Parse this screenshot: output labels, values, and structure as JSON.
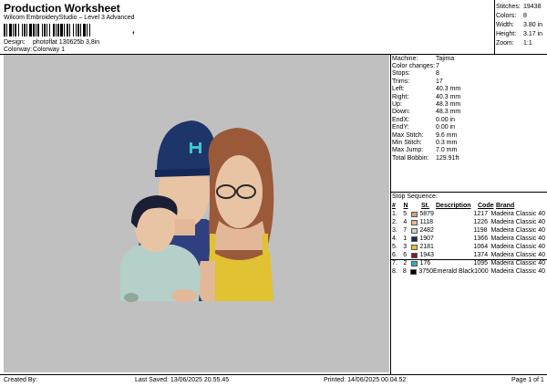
{
  "header": {
    "title": "Production Worksheet",
    "subtitle": "Wilcom EmbroideryStudio – Level 3 Advanced",
    "barcode_suffix": ","
  },
  "design_info": {
    "design_label": "Design:",
    "design_value": "photoflat 130625b 3,8in",
    "colorway_label": "Colorway:",
    "colorway_value": "Colorway 1"
  },
  "stats": [
    {
      "key": "Stitches:",
      "value": "19438"
    },
    {
      "key": "Colors:",
      "value": "8"
    },
    {
      "key": "Width:",
      "value": "3.80 in"
    },
    {
      "key": "Height:",
      "value": "3.17 in"
    },
    {
      "key": "Zoom:",
      "value": "1:1"
    }
  ],
  "machine_info": [
    {
      "key": "Machine:",
      "value": "Tajima"
    },
    {
      "key": "Color changes:",
      "value": "7"
    },
    {
      "key": "Stops:",
      "value": "8"
    },
    {
      "key": "Trims:",
      "value": "17"
    },
    {
      "key": "Left:",
      "value": "40.3 mm"
    },
    {
      "key": "Right:",
      "value": "40.3 mm"
    },
    {
      "key": "Up:",
      "value": "48.3 mm"
    },
    {
      "key": "Down:",
      "value": "48.3 mm"
    },
    {
      "key": "EndX:",
      "value": "0.00 in"
    },
    {
      "key": "EndY:",
      "value": "0.00 in"
    },
    {
      "key": "Max Stitch:",
      "value": "9.6 mm"
    },
    {
      "key": "Min Stitch:",
      "value": "0.3 mm"
    },
    {
      "key": "Max Jump:",
      "value": "7.0 mm"
    },
    {
      "key": "Total Bobbin:",
      "value": "129.91ft"
    }
  ],
  "stop_sequence": {
    "title": "Stop Sequence:",
    "headers": {
      "index": "#",
      "stop": "N",
      "st": "St.",
      "description": "Description",
      "code": "Code",
      "brand": "Brand"
    },
    "rows": [
      {
        "index": "1.",
        "stop": "5",
        "color": "#d9a07a",
        "st": "5879",
        "description": "",
        "code": "1217",
        "brand": "Madeira Classic 40"
      },
      {
        "index": "2.",
        "stop": "4",
        "color": "#e8b891",
        "st": "1118",
        "description": "",
        "code": "1226",
        "brand": "Madeira Classic 40"
      },
      {
        "index": "3.",
        "stop": "7",
        "color": "#c8d0d8",
        "st": "2482",
        "description": "",
        "code": "1198",
        "brand": "Madeira Classic 40"
      },
      {
        "index": "4.",
        "stop": "1",
        "color": "#1c2a5c",
        "st": "1907",
        "description": "",
        "code": "1366",
        "brand": "Madeira Classic 40"
      },
      {
        "index": "5.",
        "stop": "3",
        "color": "#e8c430",
        "st": "2181",
        "description": "",
        "code": "1064",
        "brand": "Madeira Classic 40"
      },
      {
        "index": "6.",
        "stop": "6",
        "color": "#7a1e3c",
        "st": "1943",
        "description": "",
        "code": "1374",
        "brand": "Madeira Classic 40"
      },
      {
        "index": "7.",
        "stop": "2",
        "color": "#2ab0b8",
        "st": "176",
        "description": "",
        "code": "1095",
        "brand": "Madeira Classic 40"
      },
      {
        "index": "8.",
        "stop": "8",
        "color": "#000000",
        "st": "3750",
        "description": "Emerald Black",
        "code": "1000",
        "brand": "Madeira Classic 40"
      }
    ]
  },
  "footer": {
    "created_by_label": "Created By:",
    "last_saved": "Last Saved: 13/06/2025 20.55.45",
    "printed": "Printed: 14/06/2025 00.04.52",
    "page": "Page 1 of 1"
  },
  "colors": {
    "background_area": "#c0c0c0",
    "cap": "#1e3569",
    "logo": "#3ec6c8",
    "shirt_man": "#2f3f80",
    "skin": "#e9c4a4",
    "hair_woman": "#9a5a3a",
    "dress": "#e0c232",
    "shirt_child": "#b4d0c8"
  }
}
